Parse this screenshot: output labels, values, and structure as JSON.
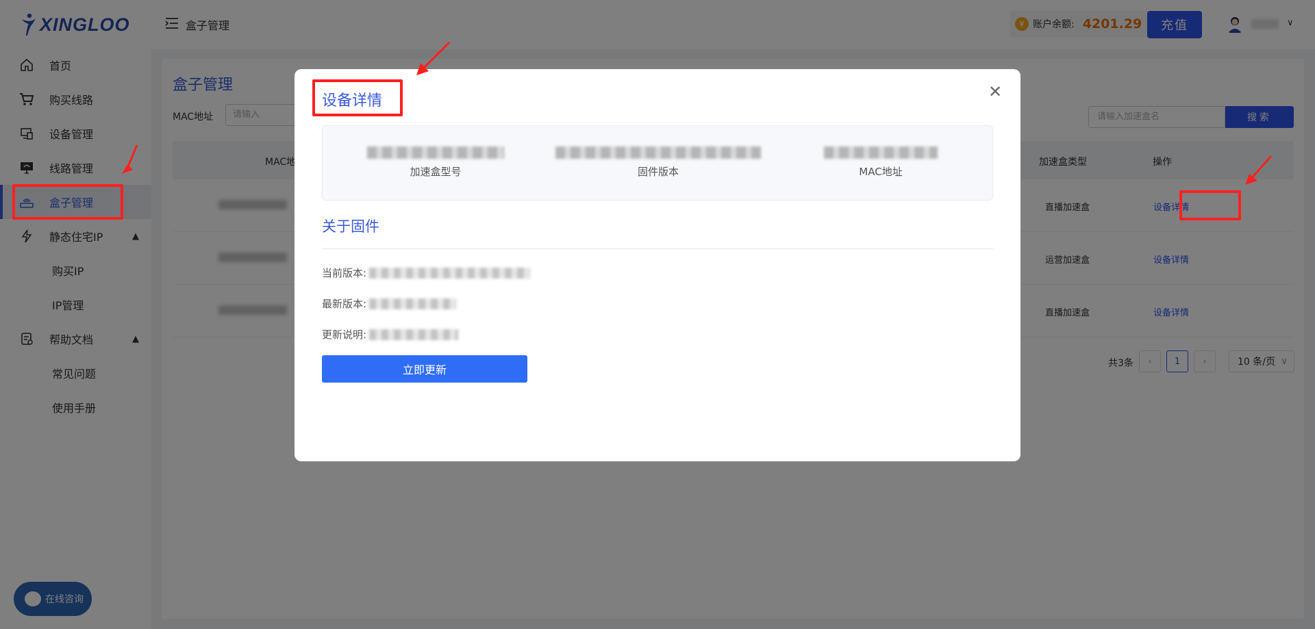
{
  "app": {
    "logo_text": "XINGLOO"
  },
  "sidebar": {
    "items": [
      {
        "label": "首页"
      },
      {
        "label": "购买线路"
      },
      {
        "label": "设备管理"
      },
      {
        "label": "线路管理"
      },
      {
        "label": "盒子管理"
      },
      {
        "label": "静态住宅IP"
      },
      {
        "label": "购买IP"
      },
      {
        "label": "IP管理"
      },
      {
        "label": "帮助文档"
      },
      {
        "label": "常见问题"
      },
      {
        "label": "使用手册"
      }
    ]
  },
  "header": {
    "title": "盒子管理",
    "balance_label": "账户余额:",
    "balance_value": "4201.29",
    "coin_symbol": "¥",
    "recharge_label": "充值"
  },
  "main": {
    "title": "盒子管理",
    "mac_label": "MAC地址",
    "mac_placeholder": "请输入",
    "search_placeholder": "请输入加速盒名",
    "search_button": "搜索",
    "columns": {
      "mac": "MAC地址",
      "type": "加速盒类型",
      "op": "操作"
    },
    "rows": [
      {
        "type": "直播加速盒",
        "op": "设备详情"
      },
      {
        "type": "运营加速盒",
        "op": "设备详情"
      },
      {
        "type": "直播加速盒",
        "op": "设备详情"
      }
    ],
    "pagination": {
      "total": "共3条",
      "prev": "‹",
      "current": "1",
      "next": "›",
      "page_size": "10 条/页"
    }
  },
  "modal": {
    "title": "设备详情",
    "close_icon": "close-icon",
    "info": [
      {
        "label": "加速盒型号"
      },
      {
        "label": "固件版本"
      },
      {
        "label": "MAC地址"
      }
    ],
    "about_title": "关于固件",
    "current_version_label": "当前版本:",
    "latest_version_label": "最新版本:",
    "notes_label": "更新说明:",
    "update_button": "立即更新"
  },
  "chat": {
    "label": "在线咨询"
  },
  "colors": {
    "accent": "#2f54eb",
    "balance": "#e8710a",
    "annotation": "#ff2020"
  }
}
